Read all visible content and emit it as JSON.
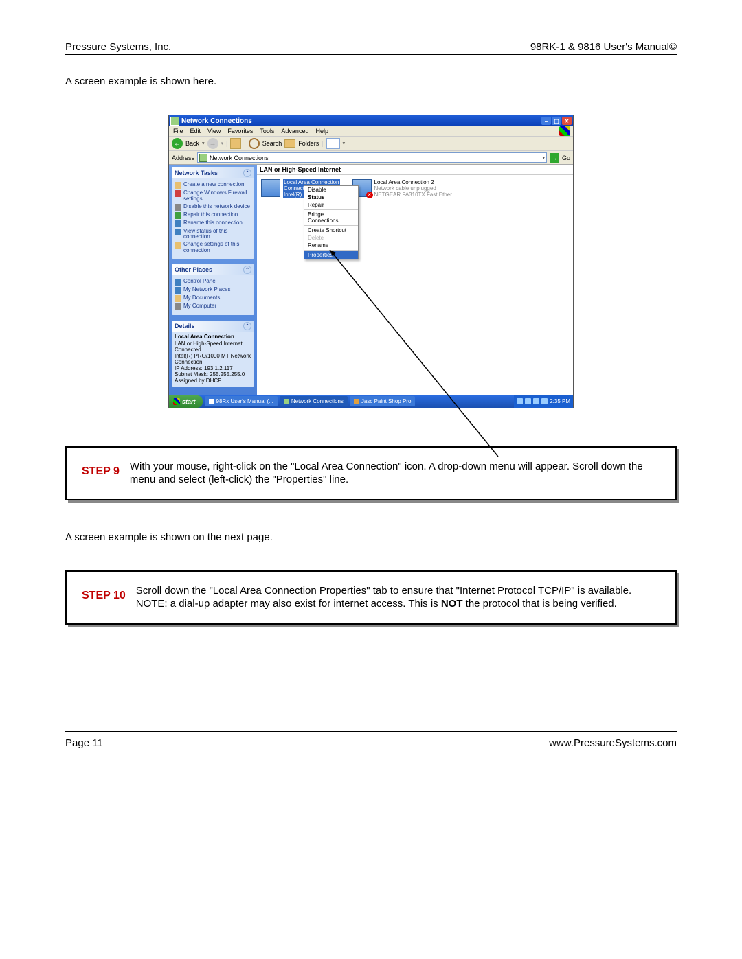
{
  "header": {
    "left": "Pressure Systems, Inc.",
    "right": "98RK-1 & 9816 User's Manual©"
  },
  "intro1": "A screen example is shown here.",
  "intro2": "A screen example is shown on the next page.",
  "footer": {
    "left": "Page 11",
    "right": "www.PressureSystems.com"
  },
  "step9": {
    "label": "STEP 9",
    "text": "With your mouse, right-click on the \"Local Area Connection\" icon.  A drop-down menu will appear.  Scroll down the menu and select (left-click) the \"Properties\" line."
  },
  "step10": {
    "label": "STEP 10",
    "text_pre": "Scroll down the \"Local Area Connection Properties\" tab to ensure that \"Internet Protocol TCP/IP\" is available. NOTE: a dial-up adapter may also exist for internet access. This is ",
    "text_bold": "NOT",
    "text_post": " the protocol that is being verified."
  },
  "xp": {
    "title": "Network Connections",
    "menus": [
      "File",
      "Edit",
      "View",
      "Favorites",
      "Tools",
      "Advanced",
      "Help"
    ],
    "toolbar": {
      "back": "Back",
      "search": "Search",
      "folders": "Folders"
    },
    "address": {
      "label": "Address",
      "value": "Network Connections",
      "go": "Go"
    },
    "panel_tasks": {
      "title": "Network Tasks",
      "items": [
        "Create a new connection",
        "Change Windows Firewall settings",
        "Disable this network device",
        "Repair this connection",
        "Rename this connection",
        "View status of this connection",
        "Change settings of this connection"
      ]
    },
    "panel_places": {
      "title": "Other Places",
      "items": [
        "Control Panel",
        "My Network Places",
        "My Documents",
        "My Computer"
      ]
    },
    "panel_details": {
      "title": "Details",
      "name": "Local Area Connection",
      "type": "LAN or High-Speed Internet",
      "status": "Connected",
      "adapter": "Intel(R) PRO/1000 MT Network Connection",
      "ip": "IP Address: 193.1.2.117",
      "mask": "Subnet Mask: 255.255.255.0",
      "assigned": "Assigned by DHCP"
    },
    "group_header": "LAN or High-Speed Internet",
    "conn1": {
      "name": "Local Area Connection",
      "status": "Connected",
      "adapter": "Intel(R) PRO..."
    },
    "conn2": {
      "name": "Local Area Connection 2",
      "status": "Network cable unplugged",
      "adapter": "NETGEAR FA310TX Fast Ether..."
    },
    "ctx": {
      "disable": "Disable",
      "status": "Status",
      "repair": "Repair",
      "bridge": "Bridge Connections",
      "shortcut": "Create Shortcut",
      "delete": "Delete",
      "rename": "Rename",
      "properties": "Properties"
    },
    "taskbar": {
      "start": "start",
      "items": [
        "98Rx User's Manual (...",
        "Network Connections",
        "Jasc Paint Shop Pro"
      ],
      "time": "2:35 PM"
    }
  }
}
